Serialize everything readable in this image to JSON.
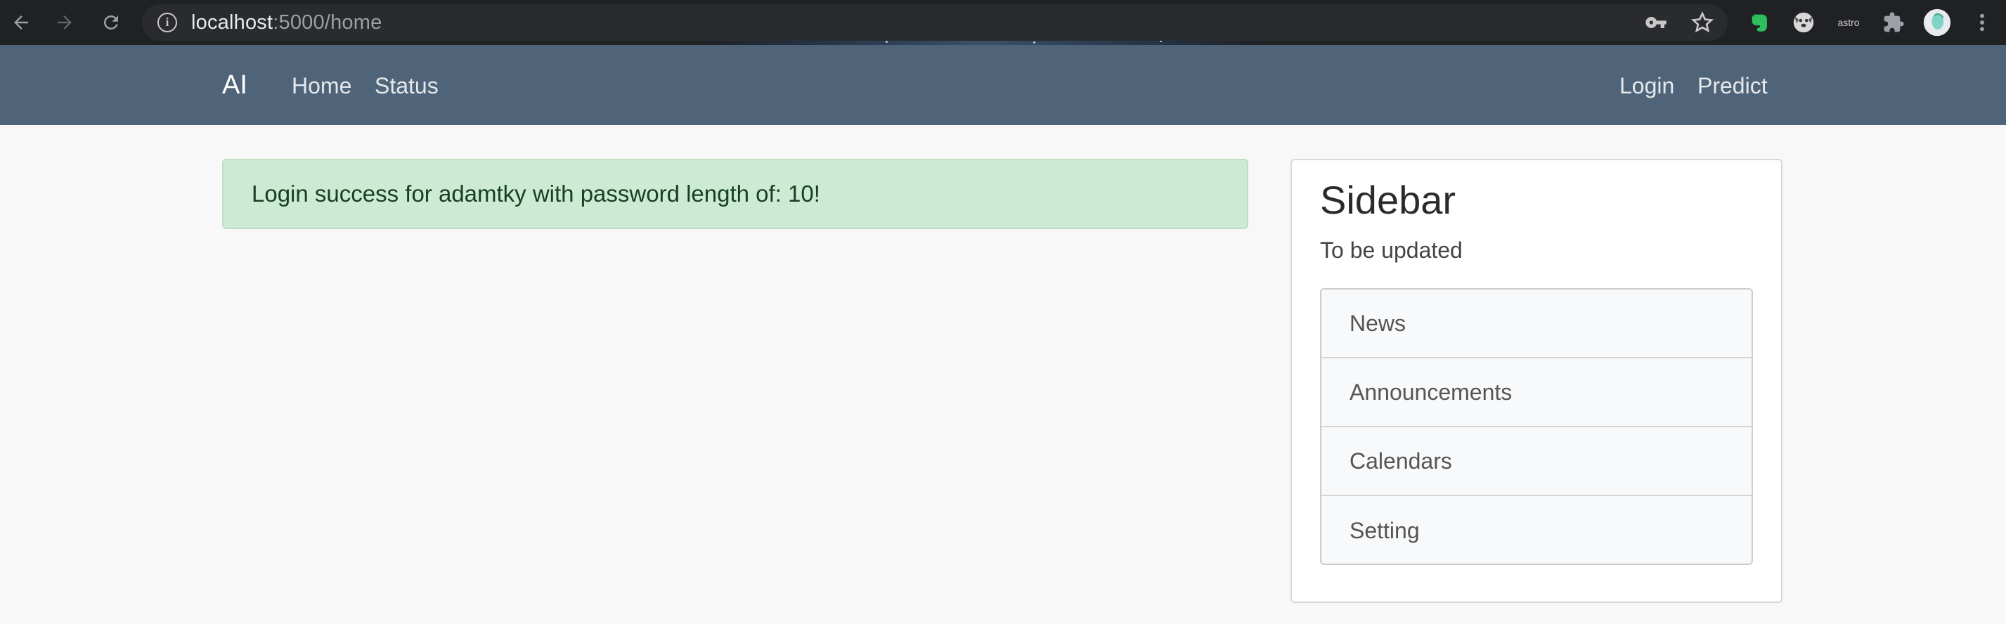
{
  "browser": {
    "url_host": "localhost",
    "url_path": ":5000/home",
    "extensions": [
      "evernote-icon",
      "dog-icon",
      "astro-icon",
      "puzzle-icon",
      "profile-avatar"
    ],
    "astro_label": "astro"
  },
  "navbar": {
    "brand": "AI",
    "left_links": [
      "Home",
      "Status"
    ],
    "right_links": [
      "Login",
      "Predict"
    ],
    "bg_color": "#4f6479"
  },
  "alert": {
    "message": "Login success for adamtky with password length of: 10!",
    "color": "#cdead4"
  },
  "sidebar": {
    "title": "Sidebar",
    "subtitle": "To be updated",
    "items": [
      "News",
      "Announcements",
      "Calendars",
      "Setting"
    ]
  }
}
